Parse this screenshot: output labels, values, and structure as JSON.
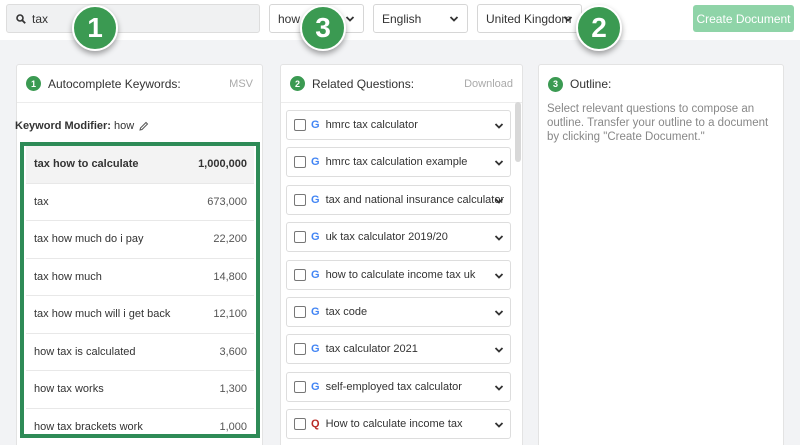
{
  "topbar": {
    "search_value": "tax",
    "question_word": "how",
    "language": "English",
    "country": "United Kingdom",
    "create_button": "Create Document"
  },
  "callouts": [
    "1",
    "3",
    "2"
  ],
  "keywords_panel": {
    "step": "1",
    "title": "Autocomplete Keywords:",
    "right_label": "MSV",
    "modifier_label": "Keyword Modifier:",
    "modifier_value": "how",
    "rows": [
      {
        "keyword": "tax how to calculate",
        "volume": "1,000,000"
      },
      {
        "keyword": "tax",
        "volume": "673,000"
      },
      {
        "keyword": "tax how much do i pay",
        "volume": "22,200"
      },
      {
        "keyword": "tax how much",
        "volume": "14,800"
      },
      {
        "keyword": "tax how much will i get back",
        "volume": "12,100"
      },
      {
        "keyword": "how tax is calculated",
        "volume": "3,600"
      },
      {
        "keyword": "how tax works",
        "volume": "1,300"
      },
      {
        "keyword": "how tax brackets work",
        "volume": "1,000"
      }
    ]
  },
  "questions_panel": {
    "step": "2",
    "title": "Related Questions:",
    "right_label": "Download",
    "items": [
      {
        "icon": "G",
        "color": "#4285f4",
        "text": "hmrc tax calculator"
      },
      {
        "icon": "G",
        "color": "#4285f4",
        "text": "hmrc tax calculation example"
      },
      {
        "icon": "G",
        "color": "#4285f4",
        "text": "tax and national insurance calculator"
      },
      {
        "icon": "G",
        "color": "#4285f4",
        "text": "uk tax calculator 2019/20"
      },
      {
        "icon": "G",
        "color": "#4285f4",
        "text": "how to calculate income tax uk"
      },
      {
        "icon": "G",
        "color": "#4285f4",
        "text": "tax code"
      },
      {
        "icon": "G",
        "color": "#4285f4",
        "text": "tax calculator 2021"
      },
      {
        "icon": "G",
        "color": "#4285f4",
        "text": "self-employed tax calculator"
      },
      {
        "icon": "Q",
        "color": "#b92b27",
        "text": "How to calculate income tax"
      }
    ]
  },
  "outline_panel": {
    "step": "3",
    "title": "Outline:",
    "description": "Select relevant questions to compose an outline. Transfer your outline to a document by clicking \"Create Document.\""
  },
  "colors": {
    "accent": "#3b9a52",
    "highlight_border": "#2e8b57",
    "button_disabled": "#8fd4a8"
  }
}
